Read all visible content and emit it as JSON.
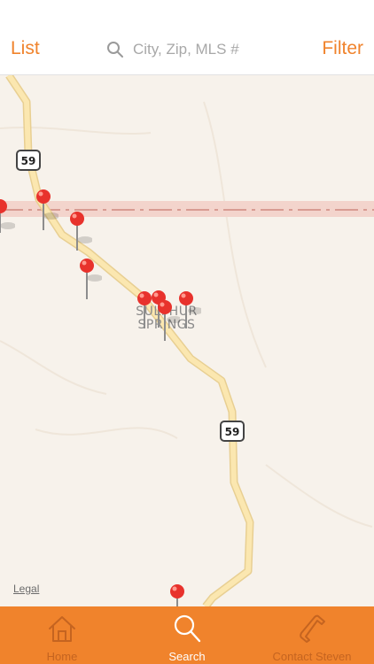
{
  "nav": {
    "left_label": "List",
    "right_label": "Filter",
    "search_placeholder": "City, Zip, MLS #",
    "accent_color": "#f0832c"
  },
  "map": {
    "highway_shield": "59",
    "town_label": "SULPHUR SPRINGS",
    "legal_label": "Legal",
    "pin_color": "#e8322c"
  },
  "tabs": [
    {
      "label": "Home",
      "icon": "home-icon",
      "active": false
    },
    {
      "label": "Search",
      "icon": "search-icon",
      "active": true
    },
    {
      "label": "Contact Steven",
      "icon": "phone-icon",
      "active": false
    }
  ]
}
